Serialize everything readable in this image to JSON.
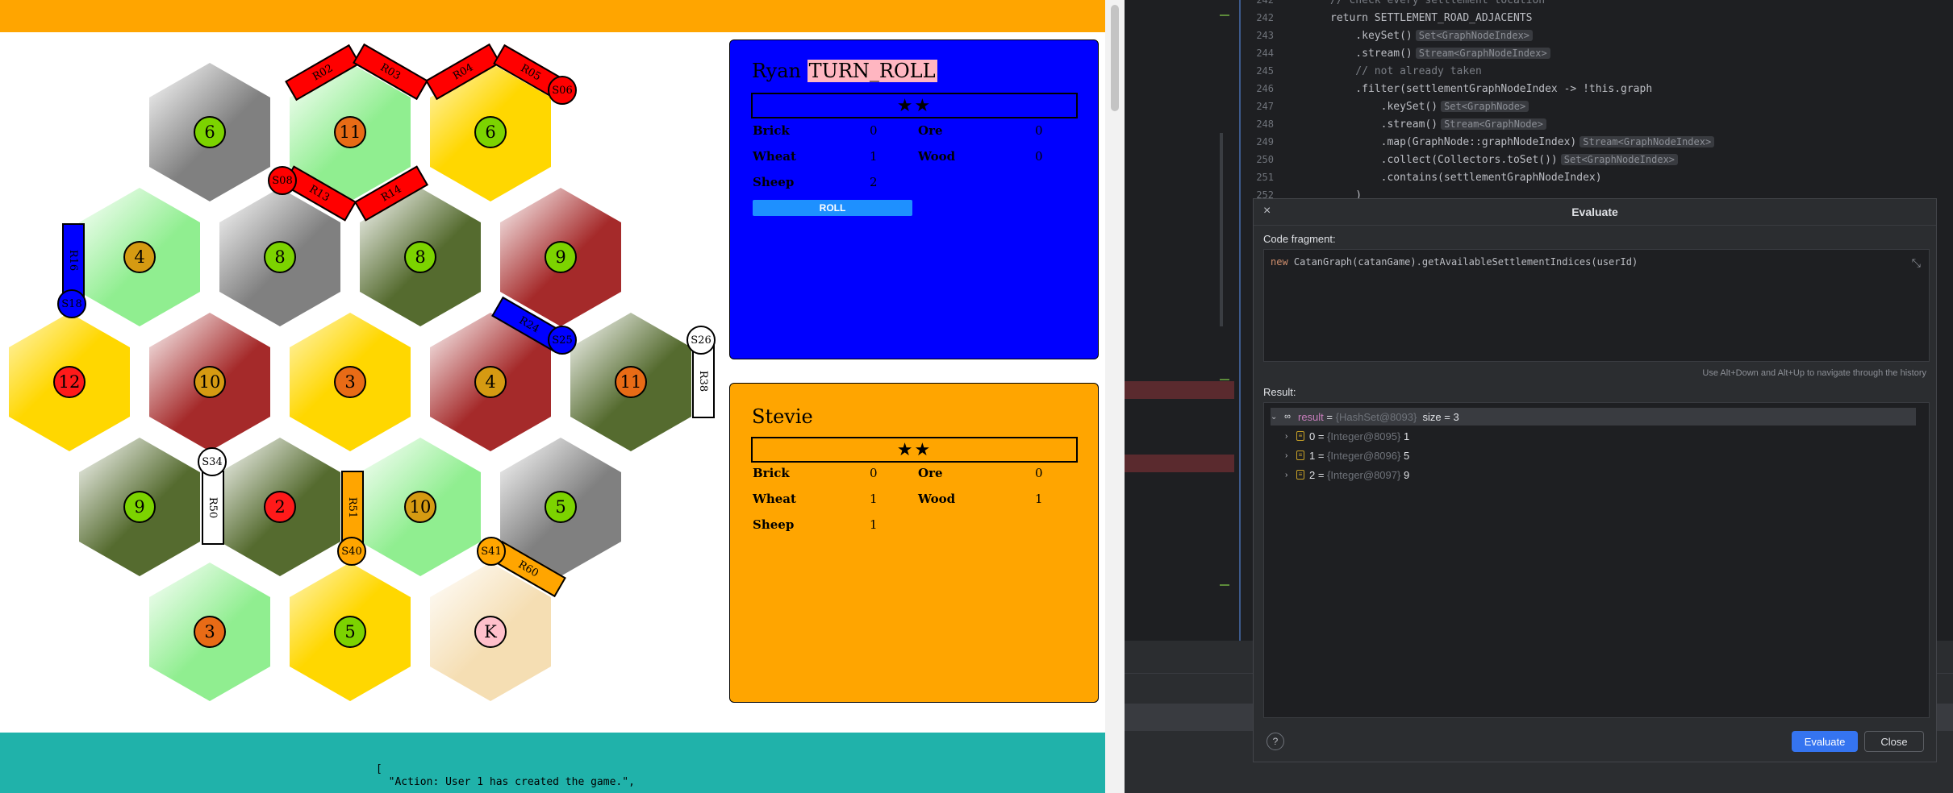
{
  "game": {
    "tiles": [
      {
        "row": 0,
        "col": 0,
        "resource": "ore",
        "number": "6",
        "color": "#808080",
        "token_color": "#7cd300"
      },
      {
        "row": 0,
        "col": 1,
        "resource": "sheep",
        "number": "11",
        "color": "#90ee90",
        "token_color": "#e86b16"
      },
      {
        "row": 0,
        "col": 2,
        "resource": "wheat",
        "number": "6",
        "color": "#ffd700",
        "token_color": "#7cd300"
      },
      {
        "row": 1,
        "col": 0,
        "resource": "sheep",
        "number": "4",
        "color": "#90ee90",
        "token_color": "#d59a12"
      },
      {
        "row": 1,
        "col": 1,
        "resource": "ore",
        "number": "8",
        "color": "#808080",
        "token_color": "#7cd300"
      },
      {
        "row": 1,
        "col": 2,
        "resource": "wood",
        "number": "8",
        "color": "#556b2f",
        "token_color": "#7cd300"
      },
      {
        "row": 1,
        "col": 3,
        "resource": "brick",
        "number": "9",
        "color": "#a52a2a",
        "token_color": "#7cd300"
      },
      {
        "row": 2,
        "col": 0,
        "resource": "wheat",
        "number": "12",
        "color": "#ffd700",
        "token_color": "#ff1a1a"
      },
      {
        "row": 2,
        "col": 1,
        "resource": "brick",
        "number": "10",
        "color": "#a52a2a",
        "token_color": "#d59a12"
      },
      {
        "row": 2,
        "col": 2,
        "resource": "wheat",
        "number": "3",
        "color": "#ffd700",
        "token_color": "#e86b16"
      },
      {
        "row": 2,
        "col": 3,
        "resource": "brick",
        "number": "4",
        "color": "#a52a2a",
        "token_color": "#d59a12"
      },
      {
        "row": 2,
        "col": 4,
        "resource": "wood",
        "number": "11",
        "color": "#556b2f",
        "token_color": "#e86b16"
      },
      {
        "row": 3,
        "col": 0,
        "resource": "wood",
        "number": "9",
        "color": "#556b2f",
        "token_color": "#7cd300"
      },
      {
        "row": 3,
        "col": 1,
        "resource": "wood",
        "number": "2",
        "color": "#556b2f",
        "token_color": "#ff1a1a"
      },
      {
        "row": 3,
        "col": 2,
        "resource": "sheep",
        "number": "10",
        "color": "#90ee90",
        "token_color": "#d59a12"
      },
      {
        "row": 3,
        "col": 3,
        "resource": "ore",
        "number": "5",
        "color": "#808080",
        "token_color": "#7cd300"
      },
      {
        "row": 4,
        "col": 0,
        "resource": "sheep",
        "number": "3",
        "color": "#90ee90",
        "token_color": "#e86b16"
      },
      {
        "row": 4,
        "col": 1,
        "resource": "wheat",
        "number": "5",
        "color": "#ffd700",
        "token_color": "#7cd300"
      },
      {
        "row": 4,
        "col": 2,
        "resource": "desert",
        "number": "K",
        "color": "#f5deb3",
        "token_color": "#ffc0cb"
      }
    ],
    "roads": [
      {
        "label": "R02",
        "color": "#ff0000"
      },
      {
        "label": "R03",
        "color": "#ff0000"
      },
      {
        "label": "R04",
        "color": "#ff0000"
      },
      {
        "label": "R05",
        "color": "#ff0000"
      },
      {
        "label": "R13",
        "color": "#ff0000"
      },
      {
        "label": "R14",
        "color": "#ff0000"
      },
      {
        "label": "R16",
        "color": "#0000ff"
      },
      {
        "label": "R24",
        "color": "#0000ff"
      },
      {
        "label": "R38",
        "color": "#ffffff"
      },
      {
        "label": "R50",
        "color": "#ffffff"
      },
      {
        "label": "R51",
        "color": "#ffa500"
      },
      {
        "label": "R60",
        "color": "#ffa500"
      }
    ],
    "settlements": [
      {
        "label": "S06",
        "color": "#ff0000"
      },
      {
        "label": "S08",
        "color": "#ff0000"
      },
      {
        "label": "S18",
        "color": "#0000ff"
      },
      {
        "label": "S25",
        "color": "#0000ff"
      },
      {
        "label": "S26",
        "color": "#ffffff"
      },
      {
        "label": "S34",
        "color": "#ffffff"
      },
      {
        "label": "S40",
        "color": "#ffa500"
      },
      {
        "label": "S41",
        "color": "#ffa500"
      }
    ],
    "players": [
      {
        "name": "Ryan",
        "turn": "TURN_ROLL",
        "stars": "★★",
        "bg": "#0000ff",
        "resources": {
          "Brick": "0",
          "Ore": "0",
          "Wheat": "1",
          "Wood": "0",
          "Sheep": "2"
        },
        "button": "ROLL"
      },
      {
        "name": "Stevie",
        "turn": "",
        "stars": "★★",
        "bg": "#ffa500",
        "resources": {
          "Brick": "0",
          "Ore": "0",
          "Wheat": "1",
          "Wood": "1",
          "Sheep": "1"
        },
        "button": ""
      }
    ],
    "log": "[\n  \"Action: User 1 has created the game.\","
  },
  "code_lines": [
    {
      "n": "242",
      "text": "// check every settlement location",
      "cls": "cm",
      "hint": ""
    },
    {
      "n": "242",
      "text": "return SETTLEMENT_ROAD_ADJACENTS",
      "cls": "",
      "hint": ""
    },
    {
      "n": "243",
      "text": "    .keySet()",
      "cls": "",
      "hint": "Set<GraphNodeIndex>"
    },
    {
      "n": "244",
      "text": "    .stream()",
      "cls": "",
      "hint": "Stream<GraphNodeIndex>"
    },
    {
      "n": "245",
      "text": "    // not already taken",
      "cls": "cm",
      "hint": ""
    },
    {
      "n": "246",
      "text": "    .filter(settlementGraphNodeIndex -> !this.graph",
      "cls": "",
      "hint": ""
    },
    {
      "n": "247",
      "text": "        .keySet()",
      "cls": "",
      "hint": "Set<GraphNode>"
    },
    {
      "n": "248",
      "text": "        .stream()",
      "cls": "",
      "hint": "Stream<GraphNode>"
    },
    {
      "n": "249",
      "text": "        .map(GraphNode::graphNodeIndex)",
      "cls": "",
      "hint": "Stream<GraphNodeIndex>"
    },
    {
      "n": "250",
      "text": "        .collect(Collectors.toSet())",
      "cls": "",
      "hint": "Set<GraphNodeIndex>"
    },
    {
      "n": "251",
      "text": "        .contains(settlementGraphNodeIndex)",
      "cls": "",
      "hint": ""
    },
    {
      "n": "252",
      "text": "    )",
      "cls": "",
      "hint": ""
    }
  ],
  "evaluate": {
    "title": "Evaluate",
    "close_x": "×",
    "fragment_label": "Code fragment:",
    "fragment": "new CatanGraph(catanGame).getAvailableSettlementIndices(userId)",
    "history_hint": "Use Alt+Down and Alt+Up to navigate through the history",
    "result_label": "Result:",
    "result_root": {
      "name": "result",
      "type": "{HashSet@8093}",
      "info": "size = 3"
    },
    "result_items": [
      {
        "idx": "0",
        "type": "{Integer@8095}",
        "val": "1"
      },
      {
        "idx": "1",
        "type": "{Integer@8096}",
        "val": "5"
      },
      {
        "idx": "2",
        "type": "{Integer@8097}",
        "val": "9"
      }
    ],
    "help": "?",
    "evaluate_btn": "Evaluate",
    "close_btn": "Close"
  }
}
